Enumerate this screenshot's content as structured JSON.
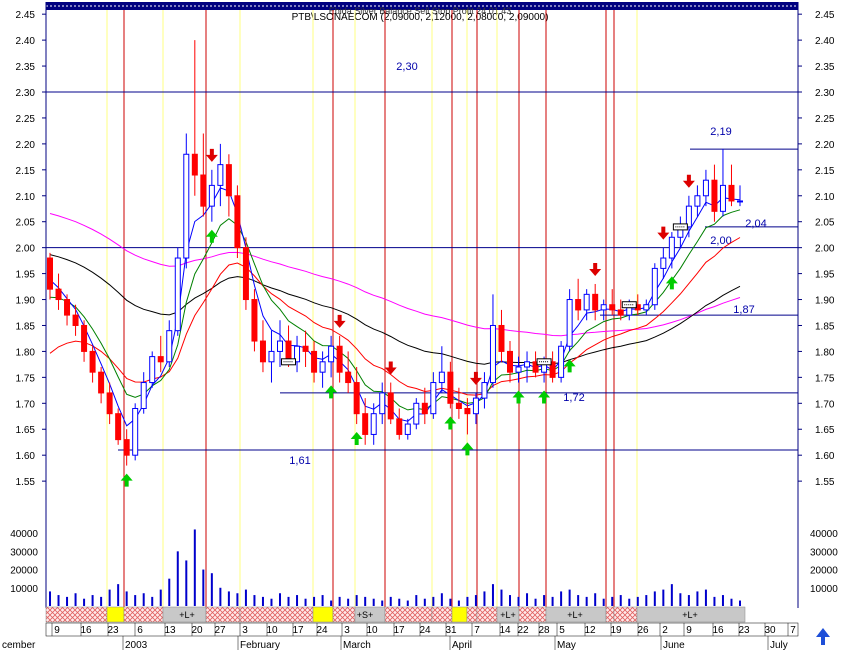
{
  "header": {
    "line1": "Ebida   Silver   Balance   Sell   Stop   Profit   24.01.43",
    "line2": "PTB\\LSONAECOM (2,09000, 2,12000, 2,08000, 2,09000)"
  },
  "chart_data": {
    "type": "candlestick",
    "instrument": "PTB\\LSONAECOM",
    "ohlc_last": {
      "open": 2.09,
      "high": 2.12,
      "low": 2.08,
      "close": 2.09
    },
    "price_axis": {
      "ylim": [
        1.5,
        2.48
      ],
      "ticks": [
        1.55,
        1.6,
        1.65,
        1.7,
        1.75,
        1.8,
        1.85,
        1.9,
        1.95,
        2.0,
        2.05,
        2.1,
        2.15,
        2.2,
        2.25,
        2.3,
        2.35,
        2.4,
        2.45
      ],
      "grid": false
    },
    "volume_axis": {
      "ylim": [
        0,
        45000
      ],
      "ticks": [
        10000,
        20000,
        30000,
        40000
      ]
    },
    "year_label": "2003",
    "months": [
      "cember",
      "February",
      "March",
      "April",
      "May",
      "June",
      "July"
    ],
    "day_ticks": [
      "9",
      "16",
      "23",
      "6",
      "13",
      "20",
      "27",
      "3",
      "10",
      "17",
      "24",
      "3",
      "10",
      "17",
      "24",
      "31",
      "7",
      "14",
      "22",
      "28",
      "5",
      "12",
      "19",
      "26",
      "2",
      "9",
      "16",
      "23",
      "30",
      "7"
    ],
    "levels": [
      {
        "value": 2.3,
        "label": "2,30"
      },
      {
        "value": 2.19,
        "label": "2,19"
      },
      {
        "value": 2.04,
        "label": "2,04"
      },
      {
        "value": 2.0,
        "label": "2,00"
      },
      {
        "value": 1.87,
        "label": "1,87"
      },
      {
        "value": 1.72,
        "label": "1,72"
      },
      {
        "value": 1.61,
        "label": "1,61"
      }
    ],
    "candles": [
      [
        1.98,
        1.99,
        1.9,
        1.92
      ],
      [
        1.92,
        1.95,
        1.88,
        1.9
      ],
      [
        1.9,
        1.91,
        1.85,
        1.87
      ],
      [
        1.87,
        1.89,
        1.83,
        1.85
      ],
      [
        1.85,
        1.86,
        1.78,
        1.8
      ],
      [
        1.8,
        1.81,
        1.74,
        1.76
      ],
      [
        1.76,
        1.77,
        1.7,
        1.72
      ],
      [
        1.72,
        1.74,
        1.66,
        1.68
      ],
      [
        1.68,
        1.69,
        1.62,
        1.63
      ],
      [
        1.63,
        1.65,
        1.58,
        1.6
      ],
      [
        1.6,
        1.7,
        1.59,
        1.69
      ],
      [
        1.69,
        1.76,
        1.68,
        1.74
      ],
      [
        1.74,
        1.8,
        1.73,
        1.79
      ],
      [
        1.79,
        1.83,
        1.76,
        1.78
      ],
      [
        1.78,
        1.86,
        1.77,
        1.84
      ],
      [
        1.84,
        2.0,
        1.83,
        1.98
      ],
      [
        1.98,
        2.22,
        1.96,
        2.18
      ],
      [
        2.18,
        2.4,
        2.1,
        2.14
      ],
      [
        2.14,
        2.22,
        2.06,
        2.08
      ],
      [
        2.08,
        2.15,
        2.05,
        2.12
      ],
      [
        2.12,
        2.2,
        2.08,
        2.16
      ],
      [
        2.16,
        2.18,
        2.06,
        2.1
      ],
      [
        2.1,
        2.12,
        1.98,
        2.0
      ],
      [
        2.0,
        2.02,
        1.88,
        1.9
      ],
      [
        1.9,
        1.92,
        1.8,
        1.82
      ],
      [
        1.82,
        1.86,
        1.76,
        1.78
      ],
      [
        1.78,
        1.84,
        1.74,
        1.8
      ],
      [
        1.8,
        1.86,
        1.77,
        1.82
      ],
      [
        1.82,
        1.85,
        1.77,
        1.78
      ],
      [
        1.78,
        1.83,
        1.76,
        1.81
      ],
      [
        1.81,
        1.84,
        1.77,
        1.8
      ],
      [
        1.8,
        1.82,
        1.74,
        1.76
      ],
      [
        1.76,
        1.8,
        1.73,
        1.78
      ],
      [
        1.78,
        1.83,
        1.75,
        1.81
      ],
      [
        1.81,
        1.83,
        1.74,
        1.76
      ],
      [
        1.76,
        1.8,
        1.72,
        1.74
      ],
      [
        1.74,
        1.77,
        1.66,
        1.68
      ],
      [
        1.68,
        1.71,
        1.62,
        1.64
      ],
      [
        1.64,
        1.7,
        1.62,
        1.68
      ],
      [
        1.68,
        1.74,
        1.66,
        1.72
      ],
      [
        1.72,
        1.74,
        1.66,
        1.67
      ],
      [
        1.67,
        1.69,
        1.63,
        1.64
      ],
      [
        1.64,
        1.67,
        1.63,
        1.66
      ],
      [
        1.66,
        1.71,
        1.65,
        1.7
      ],
      [
        1.7,
        1.73,
        1.66,
        1.68
      ],
      [
        1.68,
        1.76,
        1.67,
        1.74
      ],
      [
        1.74,
        1.81,
        1.72,
        1.76
      ],
      [
        1.76,
        1.78,
        1.69,
        1.7
      ],
      [
        1.7,
        1.73,
        1.67,
        1.69
      ],
      [
        1.69,
        1.71,
        1.64,
        1.68
      ],
      [
        1.68,
        1.72,
        1.66,
        1.71
      ],
      [
        1.71,
        1.76,
        1.69,
        1.74
      ],
      [
        1.74,
        1.91,
        1.73,
        1.85
      ],
      [
        1.85,
        1.88,
        1.78,
        1.8
      ],
      [
        1.8,
        1.82,
        1.74,
        1.76
      ],
      [
        1.76,
        1.79,
        1.74,
        1.77
      ],
      [
        1.77,
        1.8,
        1.74,
        1.78
      ],
      [
        1.78,
        1.8,
        1.75,
        1.76
      ],
      [
        1.76,
        1.79,
        1.74,
        1.78
      ],
      [
        1.78,
        1.8,
        1.74,
        1.75
      ],
      [
        1.75,
        1.82,
        1.74,
        1.81
      ],
      [
        1.81,
        1.92,
        1.8,
        1.9
      ],
      [
        1.9,
        1.94,
        1.86,
        1.88
      ],
      [
        1.88,
        1.92,
        1.86,
        1.91
      ],
      [
        1.91,
        1.93,
        1.86,
        1.88
      ],
      [
        1.88,
        1.9,
        1.86,
        1.89
      ],
      [
        1.89,
        1.92,
        1.87,
        1.88
      ],
      [
        1.88,
        1.9,
        1.86,
        1.87
      ],
      [
        1.87,
        1.9,
        1.86,
        1.89
      ],
      [
        1.89,
        1.91,
        1.87,
        1.88
      ],
      [
        1.88,
        1.9,
        1.87,
        1.89
      ],
      [
        1.89,
        1.97,
        1.88,
        1.96
      ],
      [
        1.96,
        2.0,
        1.94,
        1.98
      ],
      [
        1.98,
        2.03,
        1.96,
        2.02
      ],
      [
        2.02,
        2.06,
        2.0,
        2.04
      ],
      [
        2.04,
        2.1,
        2.02,
        2.08
      ],
      [
        2.08,
        2.12,
        2.06,
        2.1
      ],
      [
        2.1,
        2.15,
        2.08,
        2.13
      ],
      [
        2.13,
        2.16,
        2.05,
        2.07
      ],
      [
        2.07,
        2.19,
        2.06,
        2.12
      ],
      [
        2.12,
        2.16,
        2.08,
        2.09
      ],
      [
        2.09,
        2.12,
        2.08,
        2.09
      ]
    ],
    "volume": [
      8000,
      6000,
      5000,
      7000,
      4000,
      6000,
      5000,
      9000,
      12000,
      8000,
      6000,
      7000,
      5000,
      9000,
      15000,
      30000,
      25000,
      42000,
      20000,
      18000,
      10000,
      8000,
      7000,
      9000,
      6000,
      5000,
      4000,
      7000,
      5000,
      6000,
      4000,
      5000,
      6000,
      3000,
      5000,
      4000,
      6000,
      5000,
      4000,
      3000,
      5000,
      4000,
      3000,
      6000,
      4000,
      5000,
      7000,
      4000,
      3000,
      5000,
      6000,
      8000,
      12000,
      9000,
      6000,
      5000,
      7000,
      4000,
      6000,
      5000,
      8000,
      9000,
      6000,
      5000,
      7000,
      4000,
      5000,
      6000,
      4000,
      5000,
      6000,
      8000,
      9000,
      12000,
      7000,
      6000,
      8000,
      9000,
      5000,
      6000,
      4000,
      3000
    ],
    "markers": {
      "buy": [
        9,
        19,
        33,
        36,
        47,
        49,
        55,
        58,
        61,
        73
      ],
      "sell": [
        19,
        34,
        40,
        50,
        64,
        72,
        75
      ],
      "exit": [
        28,
        58,
        68,
        74
      ]
    },
    "signal_bar": {
      "segments": [
        {
          "label": ""
        },
        {
          "label": ""
        },
        {
          "label": "+L+"
        },
        {
          "label": ""
        },
        {
          "label": ""
        },
        {
          "label": "+S+"
        },
        {
          "label": ""
        },
        {
          "label": "+L+"
        },
        {
          "label": "+L+"
        },
        {
          "label": ""
        },
        {
          "label": "+L+"
        },
        {
          "label": ""
        }
      ]
    },
    "series": [
      {
        "color": "#ff00ff"
      },
      {
        "color": "#000000"
      },
      {
        "color": "#ff0000"
      },
      {
        "color": "#008000"
      },
      {
        "color": "#0000ff"
      }
    ]
  },
  "colors": {
    "border": "#00008b",
    "up_candle": "#0000ff",
    "down_candle": "#ff0000",
    "volume": "#0000cc",
    "level_line": "#00008b",
    "yellow_line": "#ffff80",
    "red_line": "#cc0000",
    "buy_arrow": "#00cc00",
    "sell_arrow": "#dd0000"
  }
}
